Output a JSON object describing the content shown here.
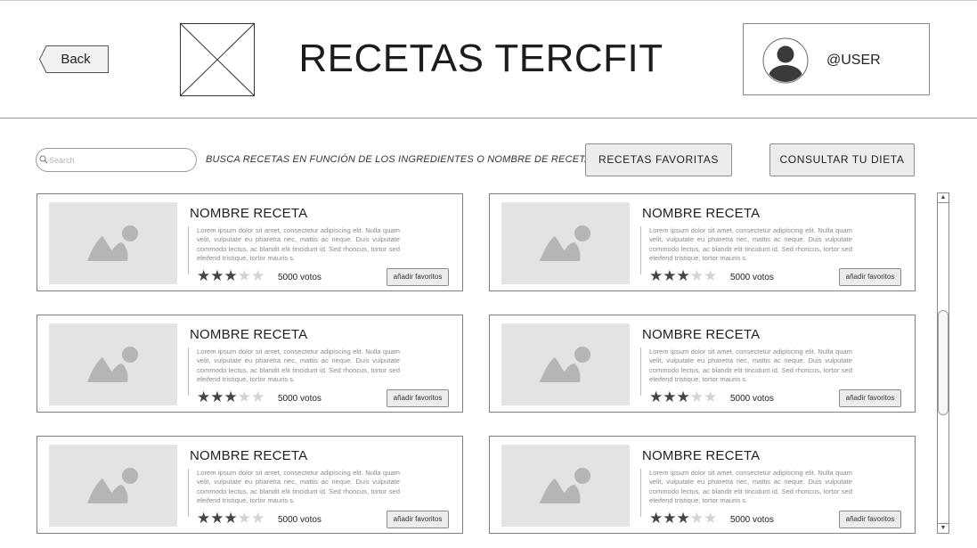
{
  "header": {
    "back_label": "Back",
    "title": "RECETAS TERCFIT",
    "username": "@USER"
  },
  "search": {
    "placeholder": "Search",
    "hint": "BUSCA RECETAS EN FUNCIÓN DE LOS INGREDIENTES O NOMBRE DE RECETA"
  },
  "actions": {
    "favorites_label": "RECETAS FAVORITAS",
    "diet_label": "CONSULTAR TU DIETA"
  },
  "recipes": [
    {
      "name": "NOMBRE RECETA",
      "description": "Lorem ipsum dolor sit amet, consectetur adipiscing elit. Nulla quam velit, vulputate eu pharetra nec, mattis ac neque. Duis vulputate commodo lectus, ac blandit elit tincidunt id. Sed rhoncus, tortor sed eleifend tristique, tortor mauris s.",
      "rating": 3,
      "votes": "5000 votos",
      "fav_label": "añadir favoritos"
    },
    {
      "name": "NOMBRE RECETA",
      "description": "Lorem ipsum dolor sit amet, consectetur adipiscing elit. Nulla quam velit, vulputate eu pharetra nec, mattis ac neque. Duis vulputate commodo lectus, ac blandit elit tincidunt id. Sed rhoncus, tortor sed eleifend tristique, tortor mauris s.",
      "rating": 3,
      "votes": "5000 votos",
      "fav_label": "añadir favoritos"
    },
    {
      "name": "NOMBRE RECETA",
      "description": "Lorem ipsum dolor sit amet, consectetur adipiscing elit. Nulla quam velit, vulputate eu pharetra nec, mattis ac neque. Duis vulputate commodo lectus, ac blandit elit tincidunt id. Sed rhoncus, tortor sed eleifend tristique, tortor mauris s.",
      "rating": 3,
      "votes": "5000 votos",
      "fav_label": "añadir favoritos"
    },
    {
      "name": "NOMBRE RECETA",
      "description": "Lorem ipsum dolor sit amet, consectetur adipiscing elit. Nulla quam velit, vulputate eu pharetra nec, mattis ac neque. Duis vulputate commodo lectus, ac blandit elit tincidunt id. Sed rhoncus, tortor sed eleifend tristique, tortor mauris s.",
      "rating": 3,
      "votes": "5000 votos",
      "fav_label": "añadir favoritos"
    },
    {
      "name": "NOMBRE RECETA",
      "description": "Lorem ipsum dolor sit amet, consectetur adipiscing elit. Nulla quam velit, vulputate eu pharetra nec, mattis ac neque. Duis vulputate commodo lectus, ac blandit elit tincidunt id. Sed rhoncus, tortor sed eleifend tristique, tortor mauris s.",
      "rating": 3,
      "votes": "5000 votos",
      "fav_label": "añadir favoritos"
    },
    {
      "name": "NOMBRE RECETA",
      "description": "Lorem ipsum dolor sit amet, consectetur adipiscing elit. Nulla quam velit, vulputate eu pharetra nec, mattis ac neque. Duis vulputate commodo lectus, ac blandit elit tincidunt id. Sed rhoncus, tortor sed eleifend tristique, tortor mauris s.",
      "rating": 3,
      "votes": "5000 votos",
      "fav_label": "añadir favoritos"
    }
  ],
  "rating_max": 5,
  "icons": {
    "back": "back-arrow-icon",
    "logo": "logo-placeholder-icon",
    "avatar": "user-avatar-icon",
    "search": "search-icon",
    "recipe_image": "image-placeholder-icon",
    "star": "star-icon"
  }
}
